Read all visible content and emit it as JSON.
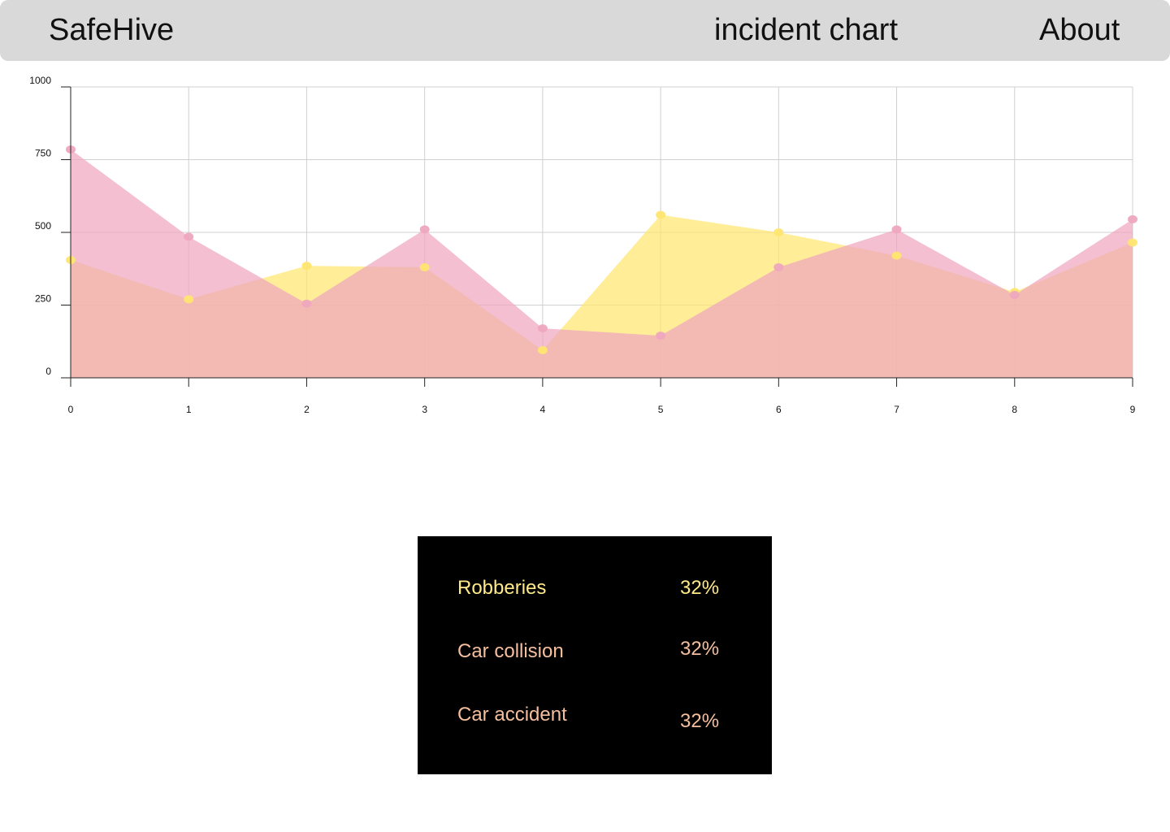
{
  "nav": {
    "brand": "SafeHive",
    "chart_link": "incident chart",
    "about_link": "About"
  },
  "colors": {
    "navbar_bg": "#d9d9d9",
    "series_yellow": "#ffe670",
    "series_pink": "#eea6bf",
    "legend_bg": "#000000",
    "legend_yellow": "#ffe98a",
    "legend_peach": "#f5bf9d"
  },
  "chart_data": {
    "type": "area",
    "x": [
      0,
      1,
      2,
      3,
      4,
      5,
      6,
      7,
      8,
      9
    ],
    "x_tick_labels": [
      "0",
      "1",
      "2",
      "3",
      "4",
      "5",
      "6",
      "7",
      "8",
      "9"
    ],
    "y_tick_labels": [
      "0",
      "250",
      "500",
      "750",
      "1000"
    ],
    "y_ticks": [
      0,
      250,
      500,
      750,
      1000
    ],
    "ylim": [
      0,
      1000
    ],
    "xlim": [
      0,
      9
    ],
    "grid": true,
    "series": [
      {
        "color": "#ffe670",
        "values": [
          405,
          270,
          385,
          380,
          95,
          560,
          500,
          420,
          295,
          465
        ]
      },
      {
        "color": "#eea6bf",
        "values": [
          785,
          485,
          255,
          510,
          170,
          145,
          380,
          510,
          285,
          545
        ]
      }
    ]
  },
  "legend": {
    "items": [
      {
        "label": "Robberies",
        "value": "32%",
        "color": "#ffe98a"
      },
      {
        "label": "Car collision",
        "value": "32%",
        "color": "#f5bf9d"
      },
      {
        "label": "Car accident",
        "value": "32%",
        "color": "#f5bf9d"
      }
    ]
  }
}
